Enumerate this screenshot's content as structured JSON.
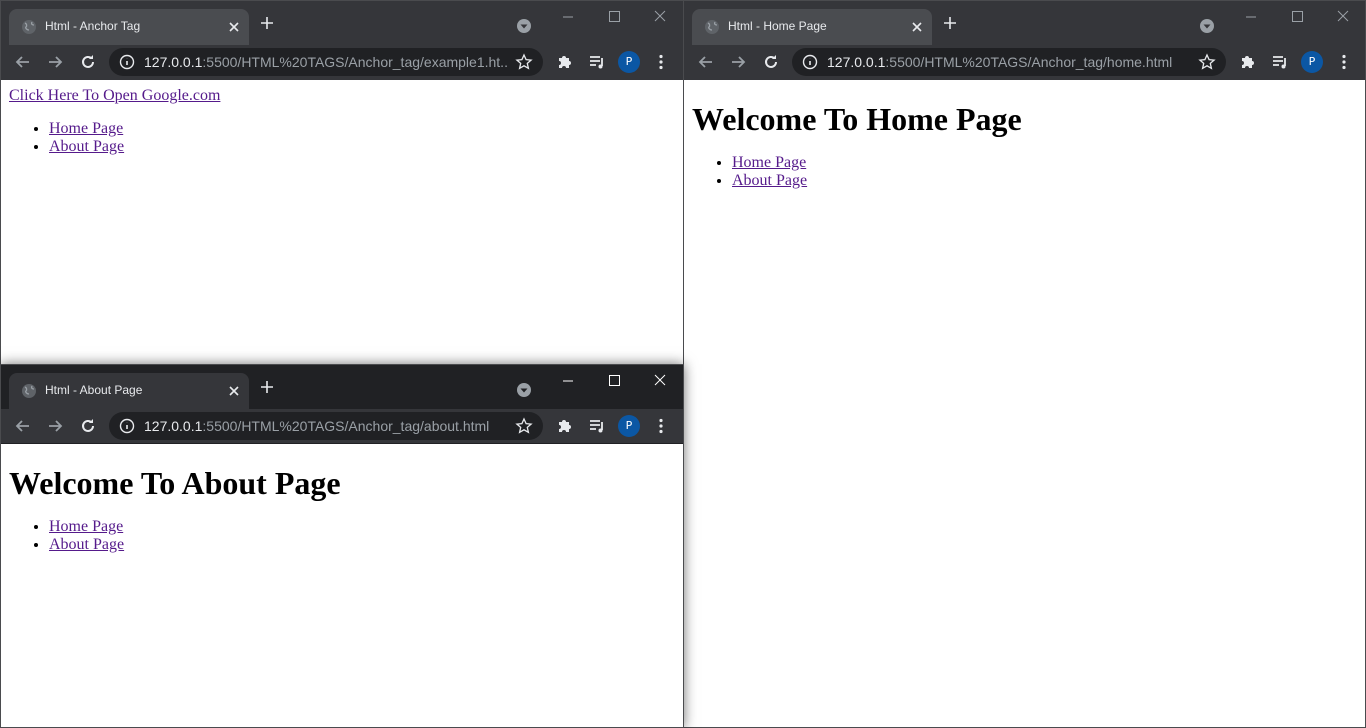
{
  "windows": {
    "anchor": {
      "tab_title": "Html - Anchor Tag",
      "url_host": "127.0.0.1",
      "url_rest": ":5500/HTML%20TAGS/Anchor_tag/example1.ht...",
      "profile": "P",
      "link_text": "Click Here To Open Google.com",
      "nav": [
        "Home Page",
        "About Page"
      ]
    },
    "home": {
      "tab_title": "Html - Home Page",
      "url_host": "127.0.0.1",
      "url_rest": ":5500/HTML%20TAGS/Anchor_tag/home.html",
      "profile": "P",
      "heading": "Welcome To Home Page",
      "nav": [
        "Home Page",
        "About Page"
      ]
    },
    "about": {
      "tab_title": "Html - About Page",
      "url_host": "127.0.0.1",
      "url_rest": ":5500/HTML%20TAGS/Anchor_tag/about.html",
      "profile": "P",
      "heading": "Welcome To About Page",
      "nav": [
        "Home Page",
        "About Page"
      ]
    }
  },
  "icons": {
    "favicon": "globe-icon",
    "close": "close-icon",
    "new_tab": "plus-icon",
    "tab_search": "chevron-down-circle-icon",
    "back": "arrow-left-icon",
    "forward": "arrow-right-icon",
    "reload": "reload-icon",
    "info": "info-icon",
    "bookmark": "star-icon",
    "extensions": "puzzle-icon",
    "media": "playlist-icon",
    "menu": "kebab-menu-icon"
  },
  "colors": {
    "chrome_dark": "#202124",
    "chrome_inactive": "#35363a",
    "link_visited": "#551a8b",
    "avatar": "#0b57a4"
  }
}
